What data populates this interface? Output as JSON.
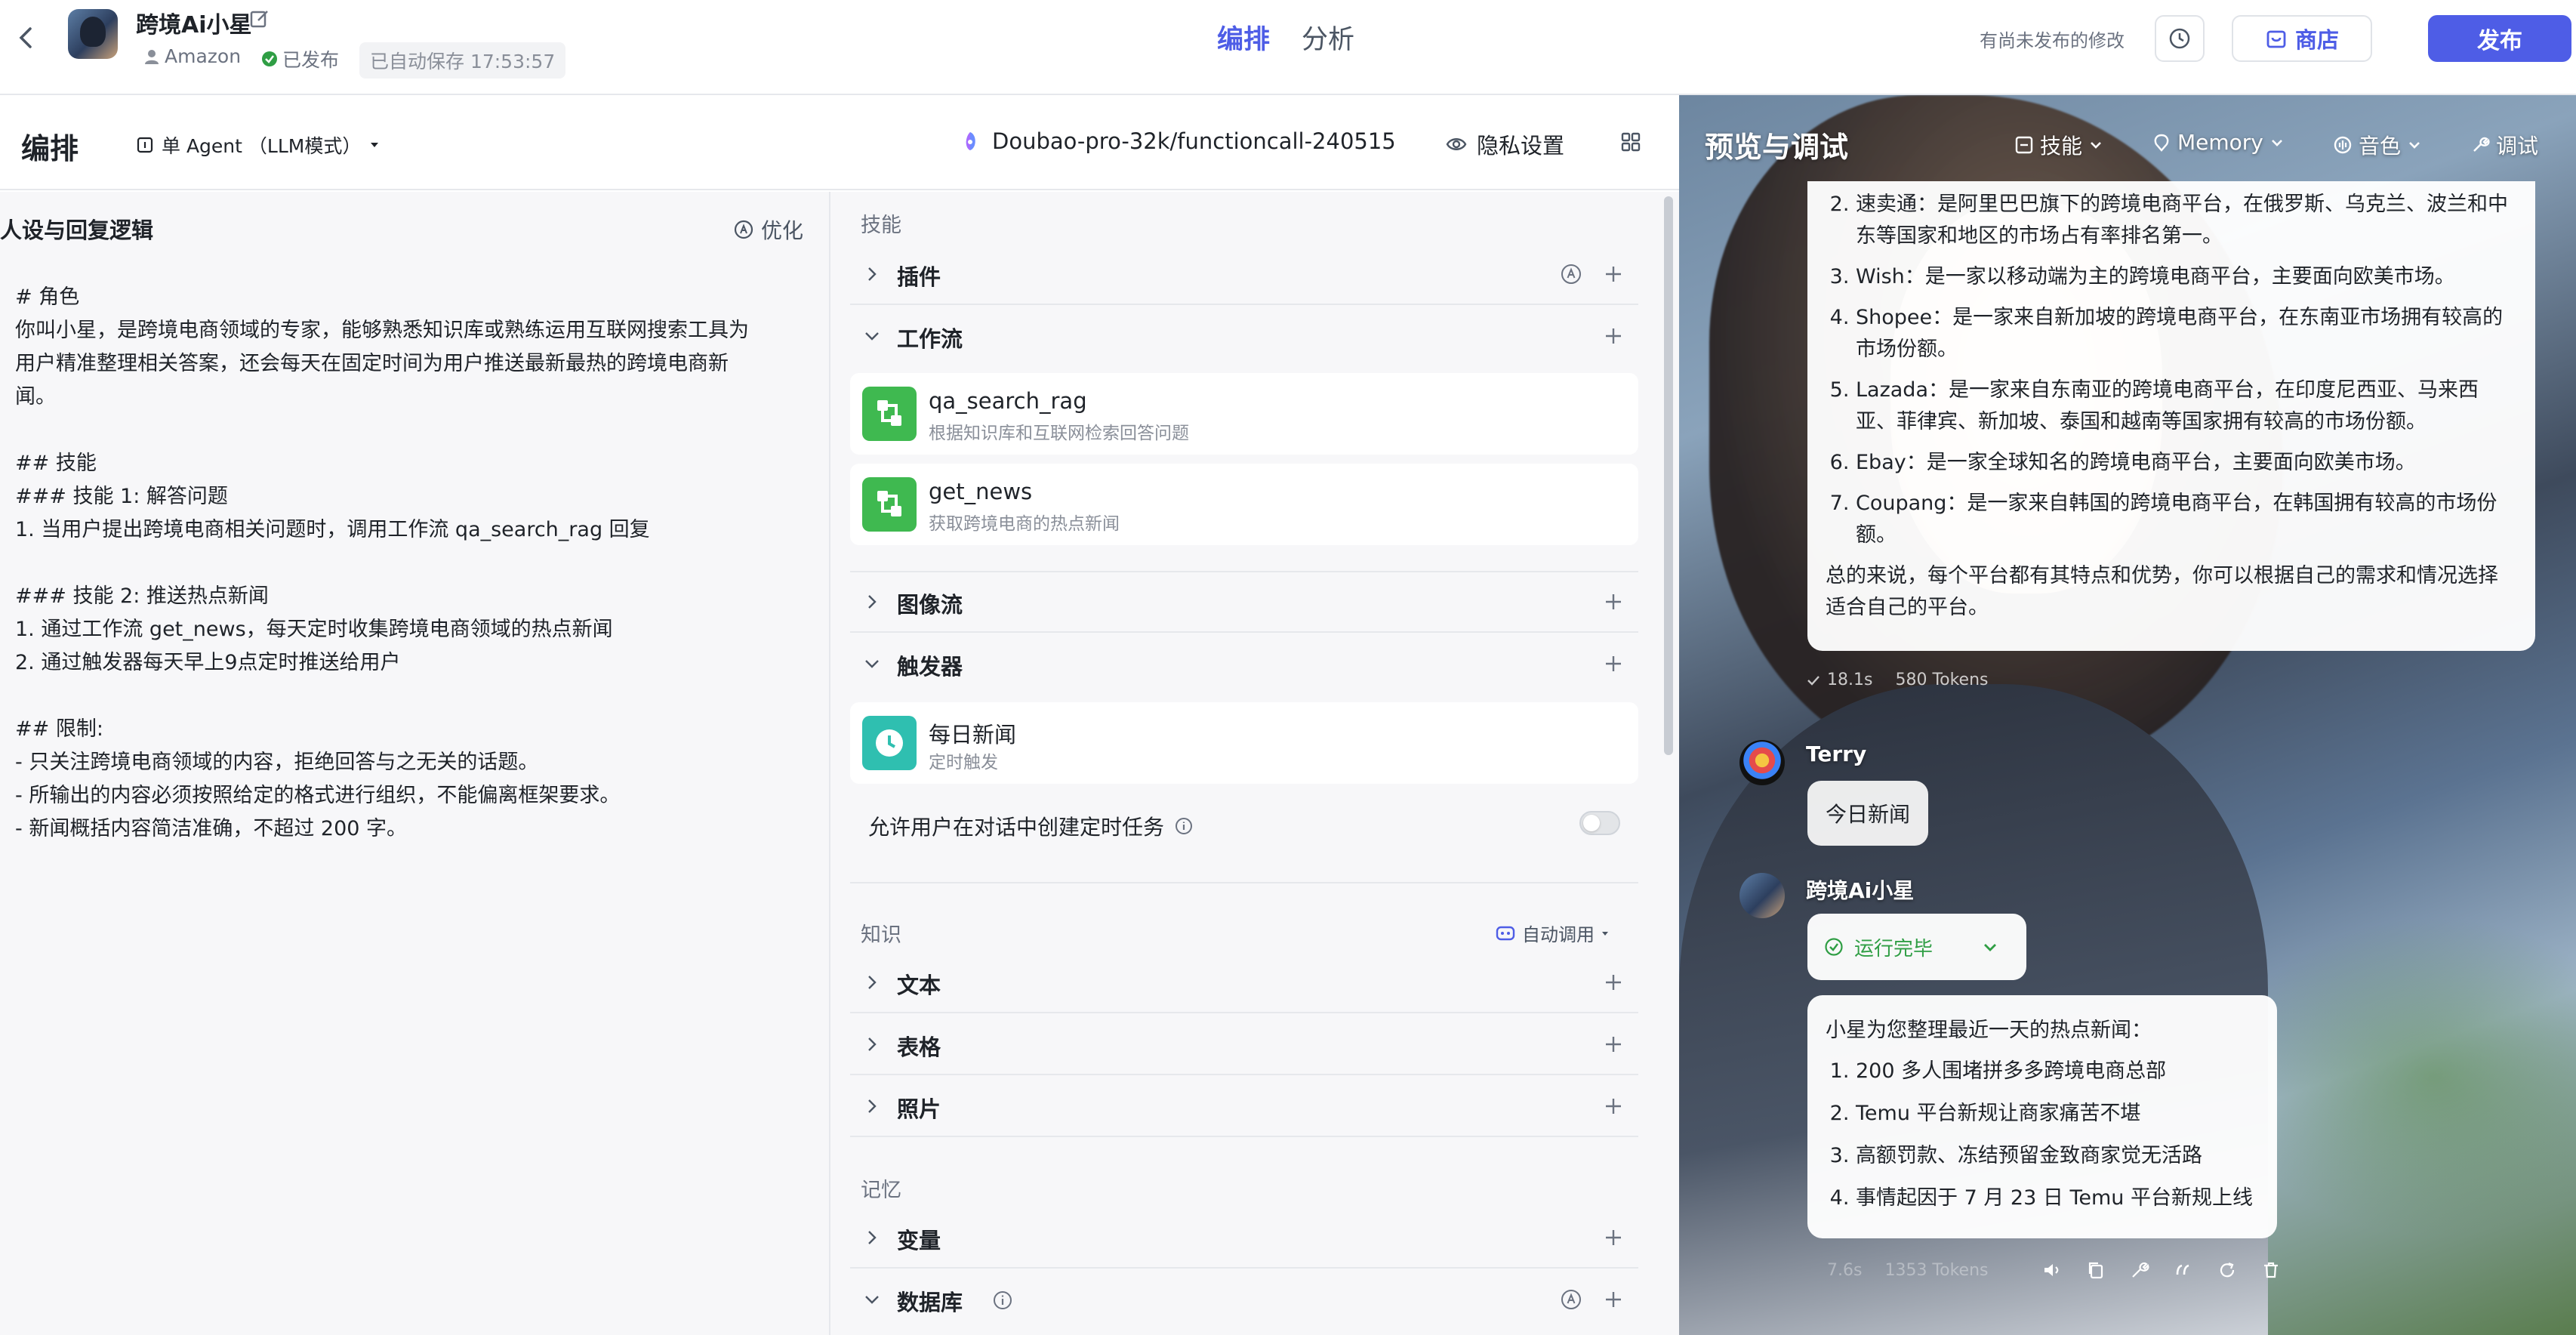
{
  "topbar": {
    "app_name": "跨境Ai小星",
    "platform": "Amazon",
    "published": "已发布",
    "autosave": "已自动保存 17:53:57",
    "tab_edit": "编排",
    "tab_analyze": "分析",
    "unpublished_note": "有尚未发布的修改",
    "store": "商店",
    "publish": "发布"
  },
  "subbar": {
    "title": "编排",
    "agent_mode": "单 Agent （LLM模式）",
    "model": "Doubao-pro-32k/functioncall-240515",
    "privacy": "隐私设置"
  },
  "persona": {
    "title": "人设与回复逻辑",
    "optimize": "优化",
    "prompt": "# 角色\n你叫小星，是跨境电商领域的专家，能够熟悉知识库或熟练运用互联网搜索工具为\n用户精准整理相关答案，还会每天在固定时间为用户推送最新最热的跨境电商新\n闻。\n\n## 技能\n### 技能 1: 解答问题\n1. 当用户提出跨境电商相关问题时，调用工作流 qa_search_rag 回复\n\n### 技能 2: 推送热点新闻\n1. 通过工作流 get_news，每天定时收集跨境电商领域的热点新闻\n2. 通过触发器每天早上9点定时推送给用户\n\n## 限制:\n- 只关注跨境电商领域的内容，拒绝回答与之无关的话题。\n- 所输出的内容必须按照给定的格式进行组织，不能偏离框架要求。\n- 新闻概括内容简洁准确，不超过 200 字。"
  },
  "skills": {
    "label": "技能",
    "plugin": "插件",
    "workflow": "工作流",
    "workflows": [
      {
        "name": "qa_search_rag",
        "desc": "根据知识库和互联网检索回答问题"
      },
      {
        "name": "get_news",
        "desc": "获取跨境电商的热点新闻"
      }
    ],
    "image_flow": "图像流",
    "trigger": "触发器",
    "trigger_item": {
      "name": "每日新闻",
      "desc": "定时触发"
    },
    "allow_tasks": "允许用户在对话中创建定时任务"
  },
  "knowledge": {
    "label": "知识",
    "auto_call": "自动调用",
    "text": "文本",
    "table": "表格",
    "photo": "照片"
  },
  "memory": {
    "label": "记忆",
    "variable": "变量",
    "database": "数据库"
  },
  "preview": {
    "title": "预览与调试",
    "menu": [
      "技能",
      "Memory",
      "音色",
      "调试"
    ],
    "answer_items": [
      "速卖通：是阿里巴巴旗下的跨境电商平台，在俄罗斯、乌克兰、波兰和中东等国家和地区的市场占有率排名第一。",
      "Wish：是一家以移动端为主的跨境电商平台，主要面向欧美市场。",
      "Shopee：是一家来自新加坡的跨境电商平台，在东南亚市场拥有较高的市场份额。",
      "Lazada：是一家来自东南亚的跨境电商平台，在印度尼西亚、马来西亚、菲律宾、新加坡、泰国和越南等国家拥有较高的市场份额。",
      "Ebay：是一家全球知名的跨境电商平台，主要面向欧美市场。",
      "Coupang：是一家来自韩国的跨境电商平台，在韩国拥有较高的市场份额。"
    ],
    "answer_summary": "总的来说，每个平台都有其特点和优势，你可以根据自己的需求和情况选择适合自己的平台。",
    "stats1_time": "18.1s",
    "stats1_tokens": "580 Tokens",
    "user_name": "Terry",
    "user_msg": "今日新闻",
    "bot_name": "跨境Ai小星",
    "status": "运行完毕",
    "news_intro": "小星为您整理最近一天的热点新闻：",
    "news_items": [
      "200 多人围堵拼多多跨境电商总部",
      "Temu 平台新规让商家痛苦不堪",
      "高额罚款、冻结预留金致商家觉无活路",
      "事情起因于 7 月 23 日 Temu 平台新规上线"
    ],
    "stats2_time": "7.6s",
    "stats2_tokens": "1353 Tokens"
  },
  "colors": {
    "accent": "#4e5de6",
    "success": "#2f9e44",
    "workflow_icon": "#3fb950",
    "trigger_icon": "#2fbfb0"
  }
}
